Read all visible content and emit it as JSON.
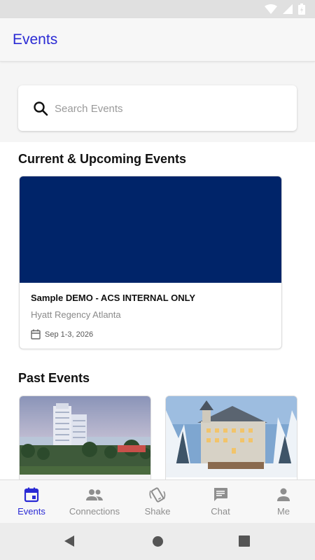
{
  "header": {
    "title": "Events"
  },
  "search": {
    "placeholder": "Search Events"
  },
  "sections": {
    "current_title": "Current & Upcoming Events",
    "past_title": "Past Events"
  },
  "current_events": [
    {
      "name": "Sample DEMO - ACS INTERNAL ONLY",
      "venue": "Hyatt Regency Atlanta",
      "date": "Sep 1-3, 2026",
      "banner_color": "#002469"
    }
  ],
  "past_events": [
    {
      "image": "tropical-hotel-photo"
    },
    {
      "image": "snowy-lodge-photo"
    }
  ],
  "bottom_nav": {
    "items": [
      {
        "label": "Events",
        "icon": "calendar-icon",
        "active": true
      },
      {
        "label": "Connections",
        "icon": "people-icon",
        "active": false
      },
      {
        "label": "Shake",
        "icon": "shake-phone-icon",
        "active": false
      },
      {
        "label": "Chat",
        "icon": "chat-icon",
        "active": false
      },
      {
        "label": "Me",
        "icon": "person-icon",
        "active": false
      }
    ]
  },
  "colors": {
    "accent": "#2a2ad4",
    "banner": "#002469",
    "inactive": "#8e8e8e"
  }
}
